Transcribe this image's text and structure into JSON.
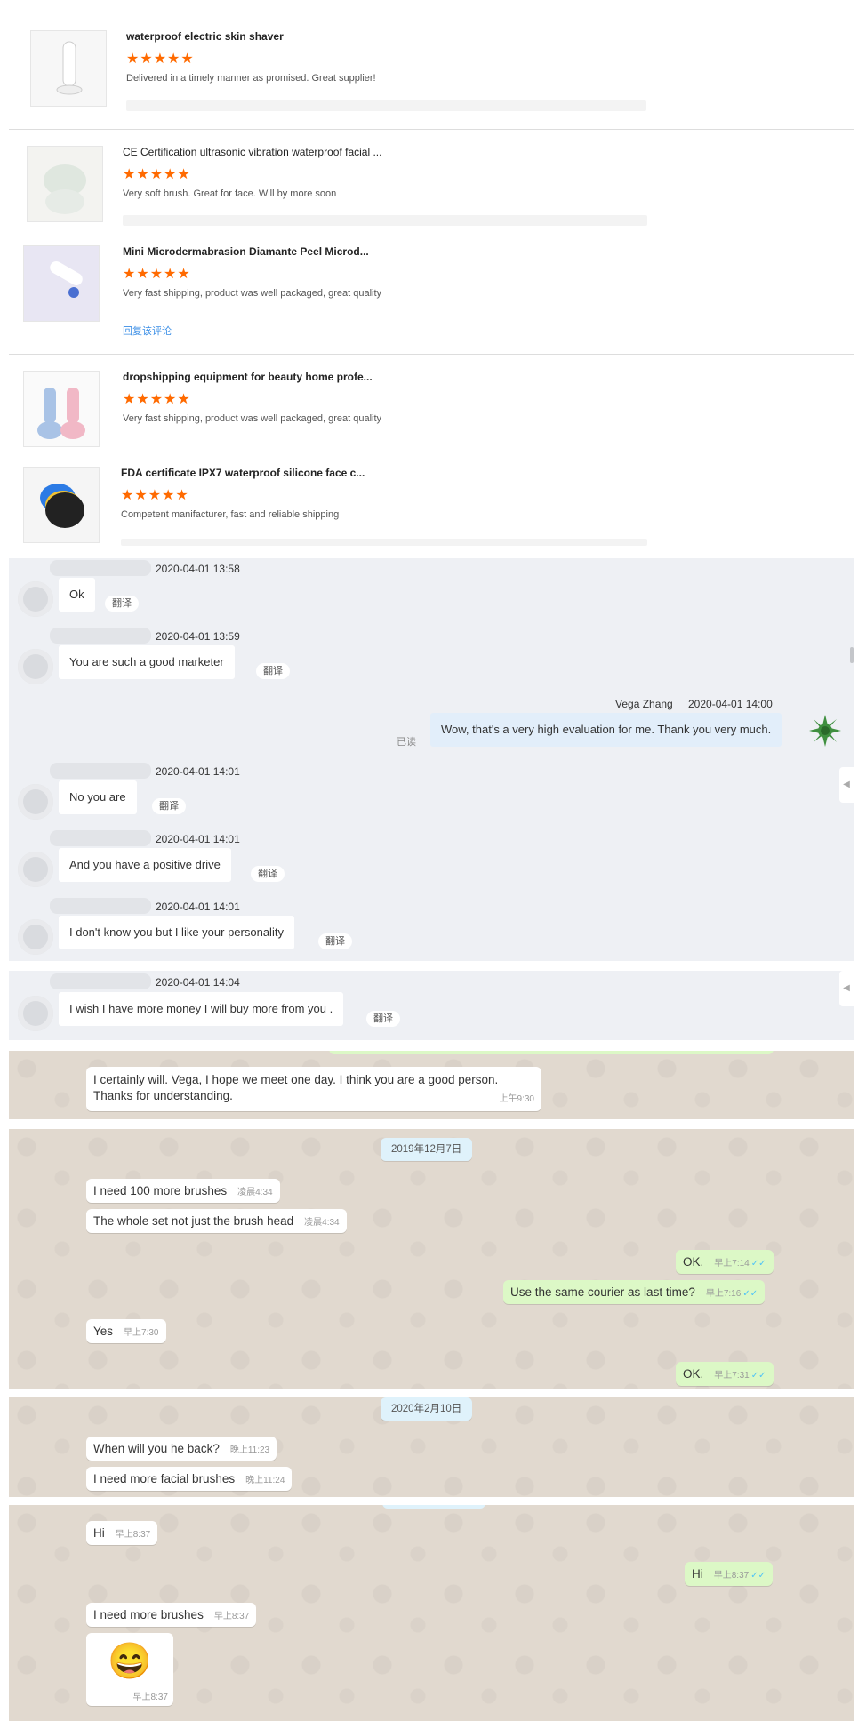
{
  "reviews": [
    {
      "title": "waterproof electric skin shaver",
      "stars": "★★★★★",
      "text": "Delivered in a timely manner as promised.  Great supplier!",
      "reply": ""
    },
    {
      "title": "CE Certification ultrasonic vibration waterproof facial ...",
      "stars": "★★★★★",
      "text": "Very soft brush. Great for face. Will by more soon",
      "reply": ""
    },
    {
      "title": "Mini Microdermabrasion Diamante Peel Microd...",
      "stars": "★★★★★",
      "text": "Very fast shipping, product was well packaged, great quality",
      "reply": "回复该评论"
    },
    {
      "title": "dropshipping equipment for beauty home profe...",
      "stars": "★★★★★",
      "text": "Very fast shipping, product was well packaged, great quality",
      "reply": ""
    },
    {
      "title": "FDA certificate IPX7 waterproof silicone face c...",
      "stars": "★★★★★",
      "text": "Competent manifacturer, fast and reliable shipping",
      "reply": ""
    }
  ],
  "chat1": {
    "translate_label": "翻译",
    "read_label": "已读",
    "messages": [
      {
        "time": "2020-04-01 13:58",
        "text": "Ok"
      },
      {
        "time": "2020-04-01 13:59",
        "text": "You are such a good marketer"
      },
      {
        "sender": "Vega Zhang",
        "time": "2020-04-01 14:00",
        "text": "Wow, that's a very high evaluation for me. Thank you very much."
      },
      {
        "time": "2020-04-01 14:01",
        "text": "No you are"
      },
      {
        "time": "2020-04-01 14:01",
        "text": "And you have a positive drive"
      },
      {
        "time": "2020-04-01 14:01",
        "text": "I don't know you but I like your personality"
      }
    ]
  },
  "chat2": {
    "time": "2020-04-01 14:04",
    "text": "I wish I have more money I will buy more from you .",
    "translate_label": "翻译"
  },
  "wa1": {
    "text1": "I certainly will. Vega, I hope we meet one day. I think you are a good person.",
    "text2": "Thanks for understanding.",
    "time": "上午9:30"
  },
  "wa2": {
    "date": "2019年12月7日",
    "msgs": [
      {
        "text": "I need 100 more brushes",
        "time": "凌晨4:34"
      },
      {
        "text": "The whole set not just the brush head",
        "time": "凌晨4:34"
      },
      {
        "text": "OK.",
        "time": "早上7:14"
      },
      {
        "text": "Use the same courier as last time?",
        "time": "早上7:16"
      },
      {
        "text": "Yes",
        "time": "早上7:30"
      },
      {
        "text": "OK.",
        "time": "早上7:31"
      }
    ]
  },
  "wa3": {
    "date": "2020年2月10日",
    "msgs": [
      {
        "text": "When will you he back?",
        "time": "晚上11:23"
      },
      {
        "text": "I need more facial brushes",
        "time": "晚上11:24"
      }
    ]
  },
  "wa4": {
    "msgs": [
      {
        "text": "Hi",
        "time": "早上8:37"
      },
      {
        "text": "Hi",
        "time": "早上8:37"
      },
      {
        "text": "I need more brushes",
        "time": "早上8:37"
      },
      {
        "text": "😄",
        "time": "早上8:37"
      }
    ]
  },
  "icons": {
    "check": "✓✓",
    "star": "★"
  }
}
